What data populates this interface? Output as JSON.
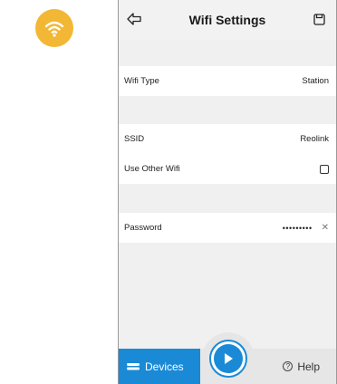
{
  "header": {
    "title": "Wifi Settings"
  },
  "settings": {
    "wifi_type": {
      "label": "Wifi Type",
      "value": "Station"
    },
    "ssid": {
      "label": "SSID",
      "value": "Reolink"
    },
    "use_other_wifi": {
      "label": "Use Other Wifi",
      "checked": false
    },
    "password": {
      "label": "Password",
      "value": "•••••••••"
    }
  },
  "tabbar": {
    "devices_label": "Devices",
    "help_label": "Help"
  },
  "colors": {
    "accent": "#1a8ad6",
    "wifi_badge": "#f2b734",
    "background": "#f0f0f0"
  },
  "icons": [
    "wifi-icon",
    "back-arrow-icon",
    "save-icon",
    "checkbox-icon",
    "clear-icon",
    "devices-icon",
    "play-icon",
    "help-icon"
  ]
}
